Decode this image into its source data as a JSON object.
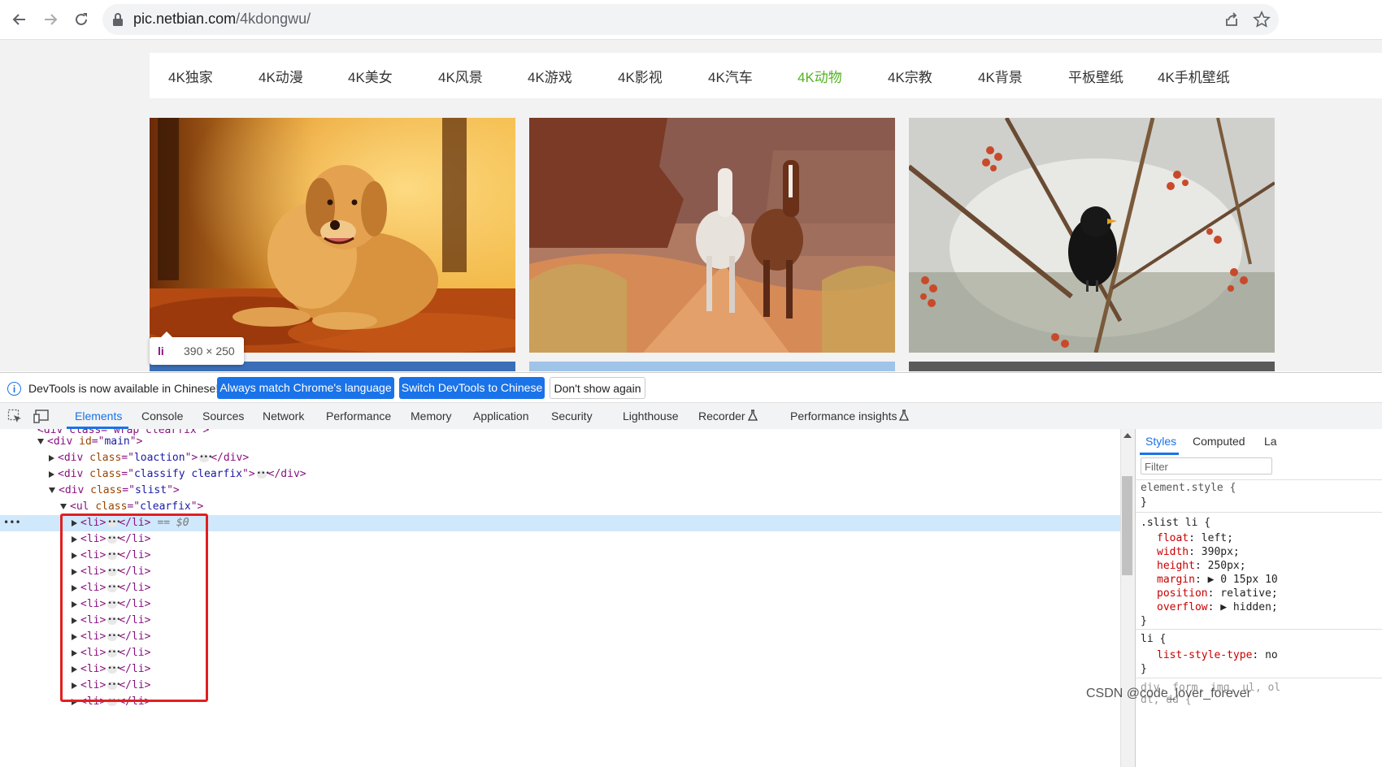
{
  "browser": {
    "url_host": "pic.netbian.com",
    "url_path": "/4kdongwu/"
  },
  "nav": {
    "items": [
      {
        "label": "4K独家"
      },
      {
        "label": "4K动漫"
      },
      {
        "label": "4K美女"
      },
      {
        "label": "4K风景"
      },
      {
        "label": "4K游戏"
      },
      {
        "label": "4K影视"
      },
      {
        "label": "4K汽车"
      },
      {
        "label": "4K动物"
      },
      {
        "label": "4K宗教"
      },
      {
        "label": "4K背景"
      },
      {
        "label": "平板壁纸"
      },
      {
        "label": "4K手机壁纸"
      }
    ],
    "active_index": 7,
    "active_color": "#52b322"
  },
  "gallery": {
    "images": [
      {
        "subject": "golden retriever dog in autumn leaves"
      },
      {
        "subject": "two horses walking on red desert trail"
      },
      {
        "subject": "blackbird on snowy branch with berries"
      }
    ]
  },
  "tooltip": {
    "tag": "li",
    "size": "390 × 250"
  },
  "infobar": {
    "message": "DevTools is now available in Chinese!",
    "btn_match": "Always match Chrome's language",
    "btn_switch": "Switch DevTools to Chinese",
    "btn_dismiss": "Don't show again"
  },
  "devtools": {
    "tabs": [
      {
        "label": "Elements"
      },
      {
        "label": "Console"
      },
      {
        "label": "Sources"
      },
      {
        "label": "Network"
      },
      {
        "label": "Performance"
      },
      {
        "label": "Memory"
      },
      {
        "label": "Application"
      },
      {
        "label": "Security"
      },
      {
        "label": "Lighthouse"
      },
      {
        "label": "Recorder"
      },
      {
        "label": "Performance insights"
      }
    ],
    "active_tab": "Elements",
    "accent_color": "#1a73e8"
  },
  "dom": {
    "cut_line": "<div class=\"wrap clearfix\">",
    "main_div": {
      "tag": "div",
      "attr": "id",
      "value": "main"
    },
    "loaction": {
      "tag": "div",
      "attr": "class",
      "value": "loaction"
    },
    "classify": {
      "tag": "div",
      "attr": "class",
      "value": "classify clearfix"
    },
    "slist": {
      "tag": "div",
      "attr": "class",
      "value": "slist"
    },
    "ul": {
      "tag": "ul",
      "attr": "class",
      "value": "clearfix"
    },
    "li_open": "<li>",
    "li_close": "</li>",
    "selected_marker": "== $0",
    "li_count": 12
  },
  "styles": {
    "tabs": [
      "Styles",
      "Computed",
      "La"
    ],
    "filter_placeholder": "Filter",
    "element_style": "element.style {",
    "close_brace": "}",
    "rule1_selector": ".slist li {",
    "rule1_props": [
      {
        "name": "float",
        "value": "left;"
      },
      {
        "name": "width",
        "value": "390px;"
      },
      {
        "name": "height",
        "value": "250px;"
      },
      {
        "name": "margin",
        "value": "▶ 0 15px 10"
      },
      {
        "name": "position",
        "value": "relative;"
      },
      {
        "name": "overflow",
        "value": "▶ hidden;"
      }
    ],
    "rule2_selector": "li {",
    "rule2_props": [
      {
        "name": "list-style-type",
        "value": "no"
      }
    ],
    "rule3_selector": "div, form, img, ul, ol",
    "rule3_selector2": "dt, dd {"
  },
  "watermark": "CSDN @code_lover_forever"
}
